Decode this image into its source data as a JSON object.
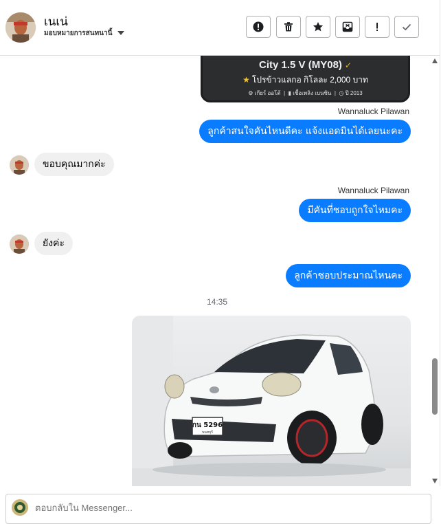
{
  "header": {
    "contact_name": "เนเน่",
    "assignee_label": "มอบหมายการสนทนานี้",
    "tool_icons": [
      "alert-circle-icon",
      "trash-icon",
      "star-icon",
      "archive-box-icon",
      "exclamation-icon",
      "checkmark-icon"
    ]
  },
  "card": {
    "title": "City 1.5 V (MY08)",
    "verified_icon": "✓",
    "price_line": "โปรข้าวแลกอ กิโลละ 2,000 บาท",
    "spec_gear": "เกียร์ ออโต้",
    "spec_fuel": "เชื้อเพลิง เบนซิน",
    "spec_year": "ปี 2013"
  },
  "messages": [
    {
      "sender": "Wannaluck Pilawan",
      "text": "ลูกค้าสนใจคันไหนดีคะ แจ้งแอดมินได้เลยนะคะ"
    },
    {
      "text": "ขอบคุณมากค่ะ"
    },
    {
      "sender": "Wannaluck Pilawan",
      "text": "มีคันที่ชอบถูกใจไหมคะ"
    },
    {
      "text": "ยังค่ะ"
    },
    {
      "text": "ลูกค้าชอบประมาณไหนคะ"
    }
  ],
  "timestamp": "14:35",
  "photo": {
    "plate_line1": "กน 5296",
    "plate_line2": "นนทบุรี"
  },
  "composer": {
    "placeholder": "ตอบกลับใน Messenger..."
  },
  "colors": {
    "outgoing_bubble": "#0a7cff",
    "incoming_bubble": "#f0f0f0",
    "card_bg": "#2b2d2f"
  }
}
